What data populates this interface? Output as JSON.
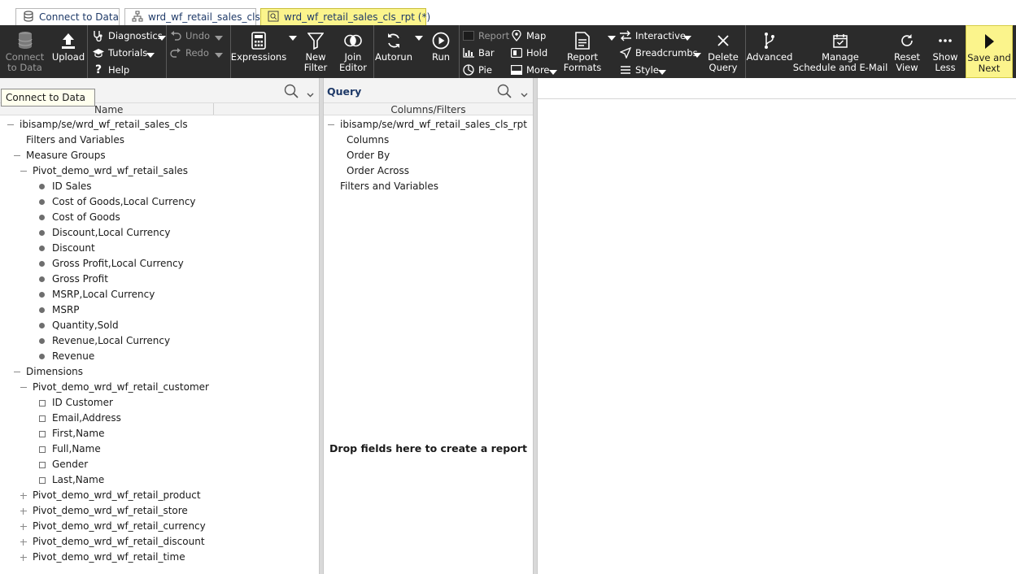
{
  "tabs": [
    {
      "label": "Connect to Data",
      "icon": "database-icon"
    },
    {
      "label": "wrd_wf_retail_sales_cls",
      "icon": "hierarchy-icon"
    },
    {
      "label": "wrd_wf_retail_sales_cls_rpt (*)",
      "icon": "report-query-icon",
      "active": true
    }
  ],
  "toolbar": {
    "connect_to_data": "Connect\nto Data",
    "upload": "Upload",
    "diagnostics": "Diagnostics",
    "tutorials": "Tutorials",
    "help": "Help",
    "undo": "Undo",
    "redo": "Redo",
    "expressions": "Expressions",
    "new_filter": "New\nFilter",
    "join_editor": "Join\nEditor",
    "autorun": "Autorun",
    "run": "Run",
    "report": "Report",
    "bar": "Bar",
    "pie": "Pie",
    "map": "Map",
    "hold": "Hold",
    "more": "More",
    "report_formats": "Report\nFormats",
    "interactive": "Interactive",
    "breadcrumbs": "Breadcrumbs",
    "style": "Style",
    "delete_query": "Delete\nQuery",
    "advanced": "Advanced",
    "manage_schedule": "Manage\nSchedule and E-Mail",
    "reset_view": "Reset\nView",
    "show_less": "Show\nLess",
    "save_and_next": "Save and\nNext"
  },
  "tooltip": "Connect to Data",
  "left_panel": {
    "column_header": "Name",
    "tree": [
      {
        "label": "ibisamp/se/wrd_wf_retail_sales_cls",
        "level": 0,
        "marker": "minus"
      },
      {
        "label": "Filters and Variables",
        "level": 1,
        "marker": "none"
      },
      {
        "label": "Measure Groups",
        "level": 1,
        "marker": "minus"
      },
      {
        "label": "Pivot_demo_wrd_wf_retail_sales",
        "level": 2,
        "marker": "minus"
      },
      {
        "label": "ID Sales",
        "level": 3,
        "marker": "dot"
      },
      {
        "label": "Cost of Goods,Local Currency",
        "level": 3,
        "marker": "dot"
      },
      {
        "label": "Cost of Goods",
        "level": 3,
        "marker": "dot"
      },
      {
        "label": "Discount,Local Currency",
        "level": 3,
        "marker": "dot"
      },
      {
        "label": "Discount",
        "level": 3,
        "marker": "dot"
      },
      {
        "label": "Gross Profit,Local Currency",
        "level": 3,
        "marker": "dot"
      },
      {
        "label": "Gross Profit",
        "level": 3,
        "marker": "dot"
      },
      {
        "label": "MSRP,Local Currency",
        "level": 3,
        "marker": "dot"
      },
      {
        "label": "MSRP",
        "level": 3,
        "marker": "dot"
      },
      {
        "label": "Quantity,Sold",
        "level": 3,
        "marker": "dot"
      },
      {
        "label": "Revenue,Local Currency",
        "level": 3,
        "marker": "dot"
      },
      {
        "label": "Revenue",
        "level": 3,
        "marker": "dot"
      },
      {
        "label": "Dimensions",
        "level": 1,
        "marker": "minus"
      },
      {
        "label": "Pivot_demo_wrd_wf_retail_customer",
        "level": 2,
        "marker": "minus"
      },
      {
        "label": "ID Customer",
        "level": 3,
        "marker": "square"
      },
      {
        "label": "Email,Address",
        "level": 3,
        "marker": "square"
      },
      {
        "label": "First,Name",
        "level": 3,
        "marker": "square"
      },
      {
        "label": "Full,Name",
        "level": 3,
        "marker": "square"
      },
      {
        "label": "Gender",
        "level": 3,
        "marker": "square"
      },
      {
        "label": "Last,Name",
        "level": 3,
        "marker": "square"
      },
      {
        "label": "Pivot_demo_wrd_wf_retail_product",
        "level": 2,
        "marker": "plus"
      },
      {
        "label": "Pivot_demo_wrd_wf_retail_store",
        "level": 2,
        "marker": "plus"
      },
      {
        "label": "Pivot_demo_wrd_wf_retail_currency",
        "level": 2,
        "marker": "plus"
      },
      {
        "label": "Pivot_demo_wrd_wf_retail_discount",
        "level": 2,
        "marker": "plus"
      },
      {
        "label": "Pivot_demo_wrd_wf_retail_time",
        "level": 2,
        "marker": "plus"
      }
    ]
  },
  "query_panel": {
    "title": "Query",
    "column_header": "Columns/Filters",
    "tree": [
      {
        "label": "ibisamp/se/wrd_wf_retail_sales_cls_rpt",
        "level": 0,
        "marker": "minus"
      },
      {
        "label": "Columns",
        "level": 1,
        "marker": "none"
      },
      {
        "label": "Order By",
        "level": 1,
        "marker": "none"
      },
      {
        "label": "Order Across",
        "level": 1,
        "marker": "none"
      },
      {
        "label": "Filters and Variables",
        "level": 0,
        "marker": "none"
      }
    ],
    "drop_message": "Drop fields here to create a report"
  },
  "colors": {
    "toolbar_bg": "#2b2b2b",
    "active_tab": "#fbf48c",
    "panel_header": "#f3f3f3",
    "title_text": "#1f3a68"
  }
}
